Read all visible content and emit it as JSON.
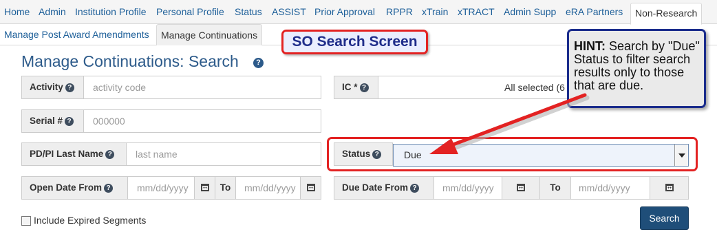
{
  "topnav": {
    "items": [
      "Home",
      "Admin",
      "Institution Profile",
      "Personal Profile",
      "Status",
      "ASSIST",
      "Prior Approval",
      "RPPR",
      "xTrain",
      "xTRACT",
      "Admin Supp",
      "eRA Partners",
      "Non-Research"
    ],
    "active": "Non-Research"
  },
  "subnav": {
    "items": [
      "Manage Post Award Amendments",
      "Manage Continuations"
    ],
    "active": "Manage Continuations"
  },
  "page": {
    "title": "Manage Continuations: Search"
  },
  "form": {
    "activity": {
      "label": "Activity",
      "placeholder": "activity code"
    },
    "ic": {
      "label": "IC *",
      "value": "All selected (6"
    },
    "serial": {
      "label": "Serial #",
      "placeholder": "000000"
    },
    "pdpi": {
      "label": "PD/PI Last Name",
      "placeholder": "last name"
    },
    "status": {
      "label": "Status",
      "value": "Due"
    },
    "open_date": {
      "label": "Open Date From",
      "from_placeholder": "mm/dd/yyyy",
      "to_label": "To",
      "to_placeholder": "mm/dd/yyyy"
    },
    "due_date": {
      "label": "Due Date From",
      "from_placeholder": "mm/dd/yyyy",
      "to_label": "To",
      "to_placeholder": "mm/dd/yyyy"
    },
    "include_expired": {
      "label": "Include Expired Segments",
      "checked": false
    },
    "search_label": "Search"
  },
  "annotations": {
    "so_callout": "SO Search Screen",
    "hint_title": "HINT:",
    "hint_text": " Search by \"Due\" Status to filter search results only to those that are due.",
    "colors": {
      "highlight": "#e32222",
      "hint_border": "#1a2c8c",
      "link": "#1d5f99",
      "button": "#1f4e79"
    }
  },
  "icons": [
    "help-icon",
    "calendar-icon",
    "chevron-down-icon",
    "checkbox-icon",
    "arrow-icon"
  ]
}
